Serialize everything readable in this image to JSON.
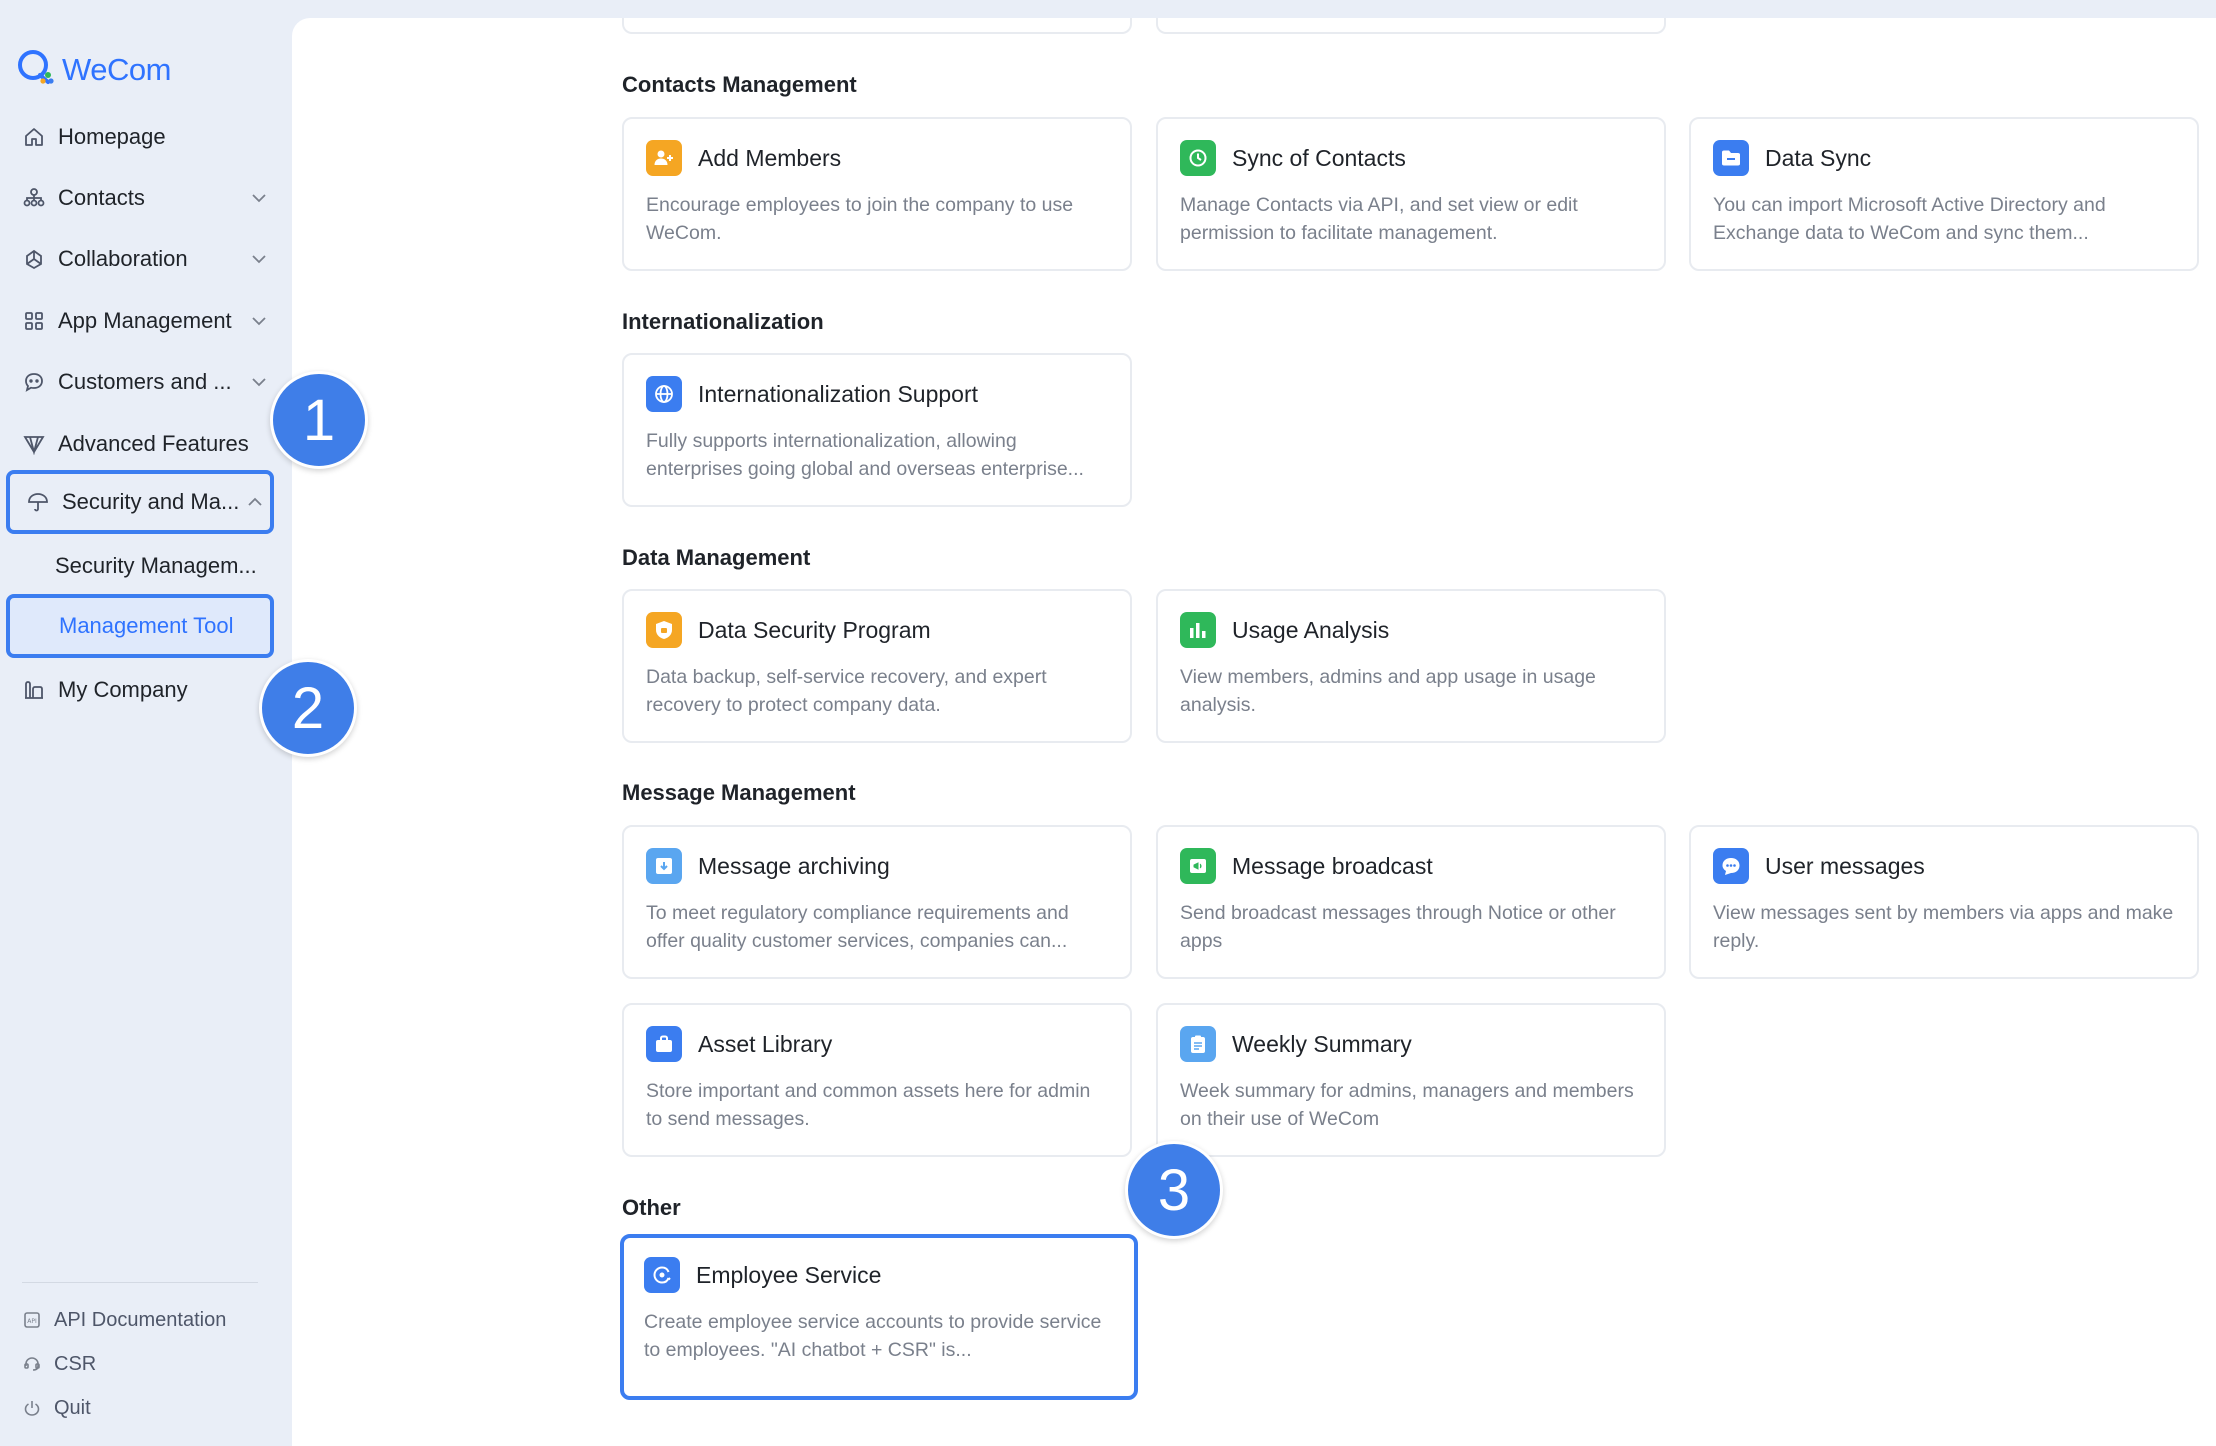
{
  "app": {
    "name": "WeCom",
    "brand_color": "#2f73ff",
    "highlight_color": "#3b7df0"
  },
  "sidebar": {
    "items": [
      {
        "label": "Homepage",
        "icon": "home-icon"
      },
      {
        "label": "Contacts",
        "icon": "org-chart-icon",
        "expandable": true
      },
      {
        "label": "Collaboration",
        "icon": "collaboration-icon",
        "expandable": true
      },
      {
        "label": "App Management",
        "icon": "grid-icon",
        "expandable": true
      },
      {
        "label": "Customers and ...",
        "icon": "chat-bubble-icon",
        "expandable": true
      },
      {
        "label": "Advanced Features",
        "icon": "diamond-icon"
      },
      {
        "label": "Security and Ma...",
        "icon": "umbrella-icon",
        "expandable": true,
        "expanded": true
      },
      {
        "label": "Security Managem...",
        "sub": true
      },
      {
        "label": "Management Tool",
        "sub": true,
        "active": true
      },
      {
        "label": "My Company",
        "icon": "building-icon"
      }
    ],
    "footer": [
      {
        "label": "API Documentation",
        "icon": "api-doc-icon"
      },
      {
        "label": "CSR",
        "icon": "headset-icon"
      },
      {
        "label": "Quit",
        "icon": "power-icon"
      }
    ]
  },
  "badges": [
    "1",
    "2",
    "3"
  ],
  "sections": [
    {
      "title": "Contacts Management",
      "cards": [
        {
          "title": "Add Members",
          "desc": "Encourage employees to join the company to use WeCom.",
          "icon": "add-members-icon",
          "color": "#f5a623"
        },
        {
          "title": "Sync of Contacts",
          "desc": "Manage Contacts via API, and set view or edit permission to facilitate management.",
          "icon": "sync-icon",
          "color": "#2fb85a"
        },
        {
          "title": "Data Sync",
          "desc": "You can import Microsoft Active Directory and Exchange data to WeCom and sync them...",
          "icon": "folder-icon",
          "color": "#3b7df0"
        }
      ]
    },
    {
      "title": "Internationalization",
      "cards": [
        {
          "title": "Internationalization Support",
          "desc": "Fully supports internationalization, allowing enterprises going global and overseas enterprise...",
          "icon": "globe-icon",
          "color": "#3b7df0"
        }
      ]
    },
    {
      "title": "Data Management",
      "cards": [
        {
          "title": "Data Security Program",
          "desc": "Data backup, self-service recovery, and expert recovery to protect company data.",
          "icon": "shield-icon",
          "color": "#f5a623"
        },
        {
          "title": "Usage Analysis",
          "desc": "View members, admins and app usage in usage analysis.",
          "icon": "bar-chart-icon",
          "color": "#2fb85a"
        }
      ]
    },
    {
      "title": "Message Management",
      "cards": [
        {
          "title": "Message archiving",
          "desc": "To meet regulatory compliance requirements and offer quality customer services, companies can...",
          "icon": "archive-icon",
          "color": "#5aa6f0"
        },
        {
          "title": "Message broadcast",
          "desc": "Send broadcast messages through Notice or other apps",
          "icon": "broadcast-icon",
          "color": "#2fb85a"
        },
        {
          "title": "User messages",
          "desc": "View messages sent by members via apps and make reply.",
          "icon": "message-icon",
          "color": "#3b7df0"
        },
        {
          "title": "Asset Library",
          "desc": "Store important and common assets here for admin to send messages.",
          "icon": "briefcase-icon",
          "color": "#3b7df0"
        },
        {
          "title": "Weekly Summary",
          "desc": "Week summary for admins, managers and members on their use of WeCom",
          "icon": "report-icon",
          "color": "#5aa6f0"
        }
      ]
    },
    {
      "title": "Other",
      "cards": [
        {
          "title": "Employee Service",
          "desc": "Create employee service accounts to provide service to employees. \"AI chatbot + CSR\" is...",
          "icon": "employee-service-icon",
          "color": "#3b7df0",
          "selected": true
        }
      ]
    }
  ]
}
